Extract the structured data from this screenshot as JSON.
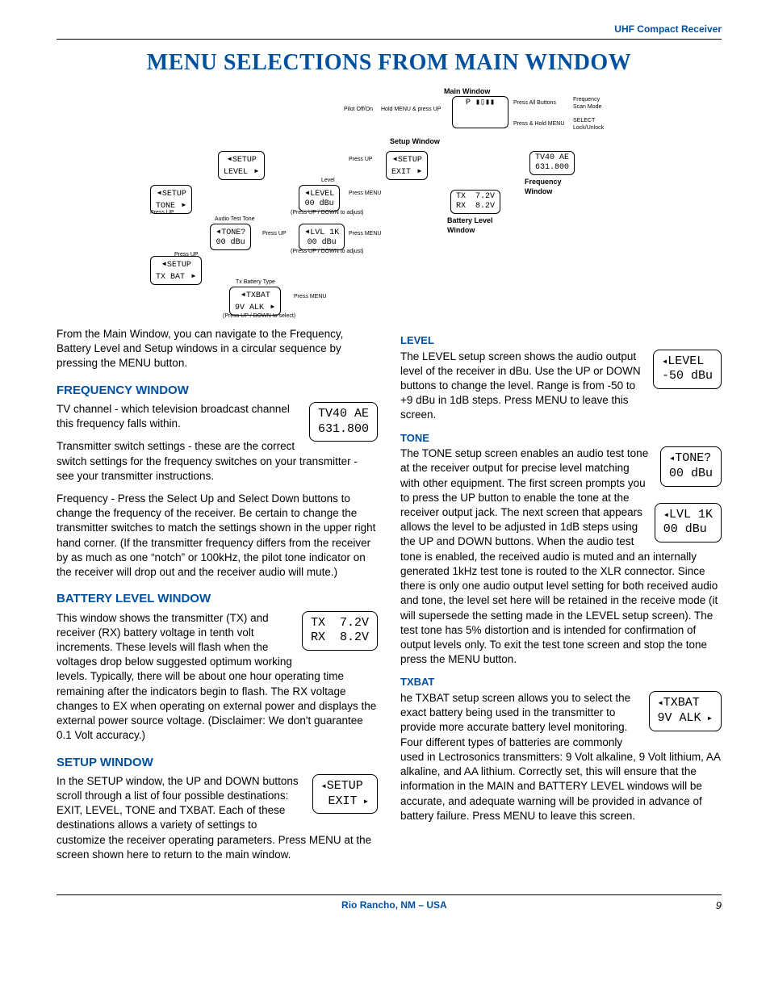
{
  "header": {
    "product": "UHF Compact Receiver"
  },
  "title": "MENU SELECTIONS FROM MAIN WINDOW",
  "diagram": {
    "labels": {
      "main": "Main Window",
      "setup": "Setup Window",
      "freq": "Frequency\nWindow",
      "batt": "Battery Level\nWindow",
      "pilot": "Pilot Off/On",
      "holdmenuup": "Hold MENU & press UP",
      "pressall": "Press All Buttons",
      "fscan": "Frequency\nScan Mode",
      "presshold": "Press & Hold MENU",
      "select": "SELECT\nLock/Unlock",
      "pressup": "Press UP",
      "pressmenu": "Press MENU",
      "level_h": "Level",
      "audiotest": "Audio Test Tone",
      "txbtype": "Tx Battery Type",
      "updown": "(Press UP / DOWN to adjust)",
      "updown_sel": "(Press UP / DOWN to select)"
    },
    "boxes": {
      "setup_level": "SETUP\nLEVEL",
      "setup_tone": "SETUP\nTONE",
      "setup_txbat": "SETUP\nTX BAT",
      "level_00": "LEVEL\n00 dBu",
      "tone_00": "TONE?\n00 dBu",
      "lvl1k_00": "LVL 1K\n00 dBu",
      "txbat_9v": "TXBAT\n9V ALK",
      "setup_exit": "SETUP\nEXIT",
      "tv40": "TV40 AE\n631.800",
      "batt": "TX  7.2V\nRX  8.2V",
      "main_p": "P"
    }
  },
  "intro": "From the Main Window, you can navigate to the Frequency, Battery Level and Setup windows in a circular sequence by pressing the MENU button.",
  "freq": {
    "heading": "FREQUENCY WINDOW",
    "p1": "TV channel - which television broadcast channel this frequency falls within.",
    "lcd": "TV40 AE\n631.800",
    "p2": "Transmitter switch settings - these are the correct switch settings for the frequency switches on your transmitter - see your transmitter instructions.",
    "p3": "Frequency - Press the Select Up and Select Down buttons to change the frequency of the receiver.   Be certain to change the transmitter switches to match the settings shown in the upper right hand corner. (If the transmitter frequency differs from the receiver by as much as one “notch” or 100kHz, the pilot tone indicator on the receiver will drop out and the receiver audio will mute.)"
  },
  "batt": {
    "heading": "BATTERY LEVEL WINDOW",
    "lcd": "TX  7.2V\nRX  8.2V",
    "p1": "This window shows the transmitter (TX) and receiver (RX) battery voltage in tenth volt increments.  These levels will flash when the voltages drop below suggested optimum working levels.  Typically, there will be about one hour operating time remaining after the indicators begin to flash. The RX voltage changes to EX when operating on external power and displays the external power source voltage. (Disclaimer: We don't guarantee 0.1 Volt accuracy.)"
  },
  "setup": {
    "heading": "SETUP WINDOW",
    "lcd": "SETUP\n EXIT",
    "p1": "In the SETUP window, the UP and DOWN buttons scroll through a list of four possible destinations:  EXIT, LEVEL, TONE and TXBAT.  Each of these destinations allows a variety of settings to customize the receiver operating parameters.  Press MENU at the screen shown here to return to the main window."
  },
  "level": {
    "heading": "LEVEL",
    "lcd": "LEVEL\n-50 dBu",
    "p1": "The LEVEL setup screen shows the audio output level of the receiver in dBu.  Use the UP or DOWN buttons to change the level. Range is from -50 to +9 dBu in 1dB steps.  Press MENU to leave this screen."
  },
  "tone": {
    "heading": "TONE",
    "lcd1": "TONE?\n00 dBu",
    "lcd2": "LVL 1K\n00 dBu",
    "p1": "The TONE setup screen enables an audio test tone at the receiver output for precise level matching with other equipment.  The first screen prompts you to press the UP button to enable the tone at the receiver output jack. The next screen that appears allows the level to be adjusted in 1dB steps using the UP and DOWN buttons.  When the audio test tone is enabled, the received audio is muted and an internally generated 1kHz test tone is routed to the XLR connector.  Since there is only one audio output level setting for both received audio and tone, the level set here will be retained in the receive mode (it will supersede the setting made in the LEVEL setup screen). The test tone has 5% distortion and is intended for confirmation of output levels only.  To exit the test tone screen and stop the tone press the MENU button."
  },
  "txbat": {
    "heading": "TXBAT",
    "lcd": "TXBAT\n9V ALK",
    "p1": "he TXBAT setup screen allows you to select the exact battery being used in the transmitter to provide more accurate battery level monitoring.  Four different types of batteries are commonly used in Lectrosonics transmitters: 9 Volt alkaline, 9 Volt lithium, AA alkaline, and AA lithium.  Correctly set, this will ensure that the information in the MAIN and BATTERY LEVEL windows will be accurate, and adequate warning will be provided in advance of battery failure.  Press MENU to leave this screen."
  },
  "footer": {
    "location": "Rio Rancho, NM – USA",
    "page": "9"
  }
}
